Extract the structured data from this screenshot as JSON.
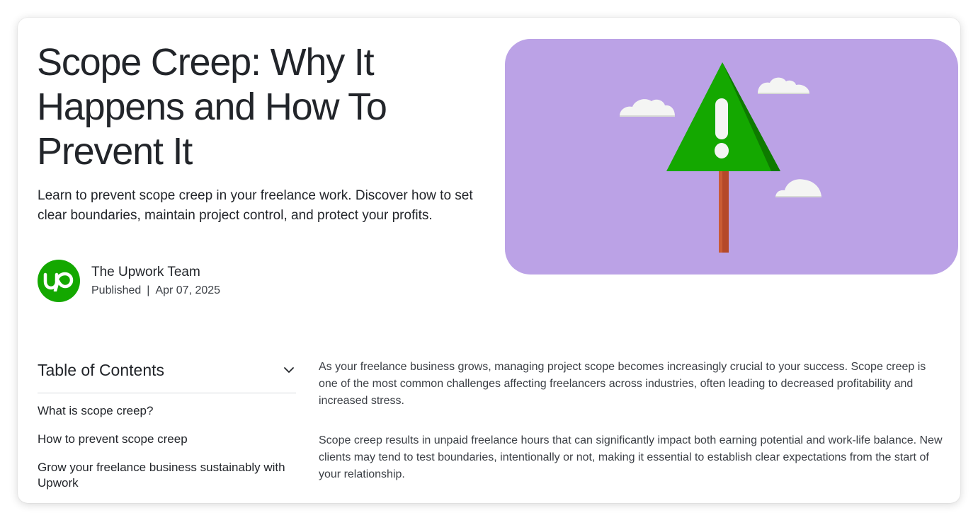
{
  "article": {
    "title": "Scope Creep: Why It Happens and How To Prevent It",
    "subtitle": "Learn to prevent scope creep in your freelance work. Discover how to set clear boundaries, maintain project control, and protect your profits.",
    "author": {
      "name": "The Upwork Team",
      "published_label": "Published",
      "separator": "|",
      "date": "Apr 07, 2025",
      "avatar_text": "up"
    }
  },
  "hero": {
    "background_color": "#bba2e6",
    "icon": "warning-sign-illustration"
  },
  "toc": {
    "title": "Table of Contents",
    "items": [
      "What is scope creep?",
      "How to prevent scope creep",
      "Grow your freelance business sustainably with Upwork"
    ]
  },
  "body": {
    "paragraphs": [
      "As your freelance business grows, managing project scope becomes increasingly crucial to your success. Scope creep is one of the most common challenges affecting freelancers across industries, often leading to decreased profitability and increased stress.",
      "Scope creep results in unpaid freelance hours that can significantly impact both earning potential and work-life balance. New clients may tend to test boundaries, intentionally or not, making it essential to establish clear expectations from the start of your relationship."
    ]
  },
  "colors": {
    "brand_green": "#14a800",
    "text_primary": "#22252a"
  }
}
